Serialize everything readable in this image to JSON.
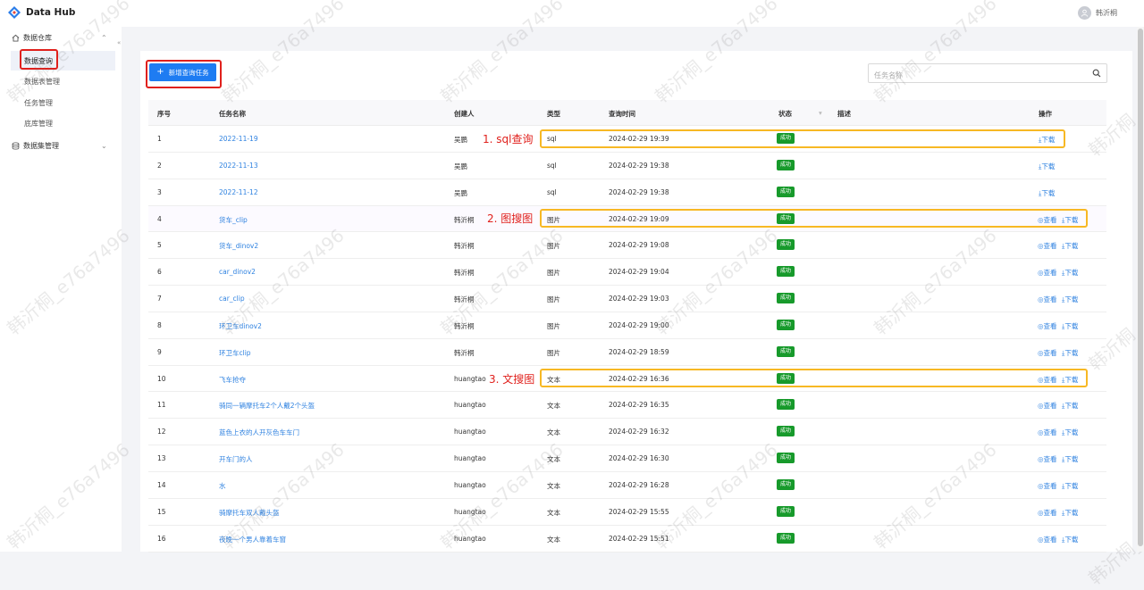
{
  "app": {
    "title": "Data Hub",
    "user": "韩沂桐"
  },
  "sidebar": {
    "group1": "数据仓库",
    "items": [
      "数据查询",
      "数据表管理",
      "任务管理",
      "底库管理"
    ],
    "group2": "数据集管理"
  },
  "toolbar": {
    "add_label": "新增查询任务",
    "search_placeholder": "任务名称"
  },
  "table": {
    "headers": {
      "index": "序号",
      "name": "任务名称",
      "creator": "创建人",
      "type": "类型",
      "time": "查询时间",
      "status": "状态",
      "desc": "描述",
      "ops": "操作"
    },
    "rows": [
      {
        "index": "1",
        "name": "2022-11-19",
        "creator": "吴鹏",
        "type": "sql",
        "time": "2024-02-29 19:39",
        "status": "成功",
        "view": false
      },
      {
        "index": "2",
        "name": "2022-11-13",
        "creator": "吴鹏",
        "type": "sql",
        "time": "2024-02-29 19:38",
        "status": "成功",
        "view": false
      },
      {
        "index": "3",
        "name": "2022-11-12",
        "creator": "吴鹏",
        "type": "sql",
        "time": "2024-02-29 19:38",
        "status": "成功",
        "view": false
      },
      {
        "index": "4",
        "name": "货车_clip",
        "creator": "韩沂桐",
        "type": "图片",
        "time": "2024-02-29 19:09",
        "status": "成功",
        "view": true
      },
      {
        "index": "5",
        "name": "货车_dinov2",
        "creator": "韩沂桐",
        "type": "图片",
        "time": "2024-02-29 19:08",
        "status": "成功",
        "view": true
      },
      {
        "index": "6",
        "name": "car_dinov2",
        "creator": "韩沂桐",
        "type": "图片",
        "time": "2024-02-29 19:04",
        "status": "成功",
        "view": true
      },
      {
        "index": "7",
        "name": "car_clip",
        "creator": "韩沂桐",
        "type": "图片",
        "time": "2024-02-29 19:03",
        "status": "成功",
        "view": true
      },
      {
        "index": "8",
        "name": "环卫车dinov2",
        "creator": "韩沂桐",
        "type": "图片",
        "time": "2024-02-29 19:00",
        "status": "成功",
        "view": true
      },
      {
        "index": "9",
        "name": "环卫车clip",
        "creator": "韩沂桐",
        "type": "图片",
        "time": "2024-02-29 18:59",
        "status": "成功",
        "view": true
      },
      {
        "index": "10",
        "name": "飞车抢夺",
        "creator": "huangtao",
        "type": "文本",
        "time": "2024-02-29 16:36",
        "status": "成功",
        "view": true
      },
      {
        "index": "11",
        "name": "骑同一辆摩托车2个人戴2个头盔",
        "creator": "huangtao",
        "type": "文本",
        "time": "2024-02-29 16:35",
        "status": "成功",
        "view": true
      },
      {
        "index": "12",
        "name": "蓝色上衣的人开灰色车车门",
        "creator": "huangtao",
        "type": "文本",
        "time": "2024-02-29 16:32",
        "status": "成功",
        "view": true
      },
      {
        "index": "13",
        "name": "开车门的人",
        "creator": "huangtao",
        "type": "文本",
        "time": "2024-02-29 16:30",
        "status": "成功",
        "view": true
      },
      {
        "index": "14",
        "name": "水",
        "creator": "huangtao",
        "type": "文本",
        "time": "2024-02-29 16:28",
        "status": "成功",
        "view": true
      },
      {
        "index": "15",
        "name": "骑摩托车双人戴头盔",
        "creator": "huangtao",
        "type": "文本",
        "time": "2024-02-29 15:55",
        "status": "成功",
        "view": true
      },
      {
        "index": "16",
        "name": "夜晚一个男人靠着车窗",
        "creator": "huangtao",
        "type": "文本",
        "time": "2024-02-29 15:51",
        "status": "成功",
        "view": true
      }
    ],
    "view_label": "查看",
    "download_label": "下载"
  },
  "annotations": [
    "1. sql查询",
    "2. 图搜图",
    "3. 文搜图"
  ],
  "watermark": "韩沂桐_e76a7496",
  "colors": {
    "primary": "#1e7cf2",
    "success": "#179a2b",
    "highlight_red": "#e0201c",
    "highlight_yellow": "#f7b824",
    "link": "#2f82e0"
  }
}
